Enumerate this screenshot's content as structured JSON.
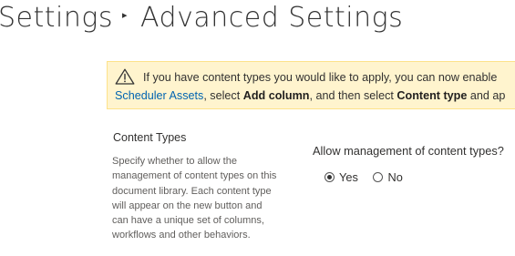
{
  "breadcrumb": {
    "parent": "Settings",
    "separator": "▸",
    "current": "Advanced Settings"
  },
  "banner": {
    "icon": "warning-icon",
    "text_before": "If you have content types you would like to apply, you can now enable",
    "link_text": "Scheduler Assets",
    "text_mid1": ", select ",
    "bold1": "Add column",
    "text_mid2": ", and then select ",
    "bold2": "Content type",
    "text_after": " and ap"
  },
  "content_types": {
    "title": "Content Types",
    "description": "Specify whether to allow the management of content types on this document library. Each content type will appear on the new button and can have a unique set of columns, workflows and other behaviors.",
    "question": "Allow management of content types?",
    "options": [
      {
        "label": "Yes",
        "selected": true
      },
      {
        "label": "No",
        "selected": false
      }
    ]
  },
  "colors": {
    "banner_bg": "#fff4ce",
    "link": "#0063b1",
    "warning": "#a67c00"
  }
}
